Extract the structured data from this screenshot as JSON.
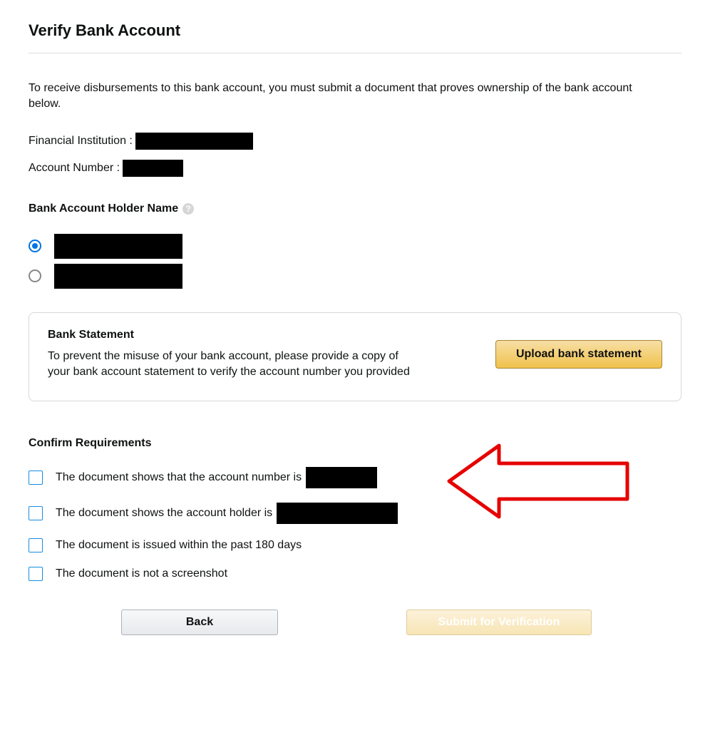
{
  "page": {
    "title": "Verify Bank Account",
    "intro": "To receive disbursements to this bank account, you must submit a document that proves ownership of the bank account below."
  },
  "fields": {
    "financial_institution_label": "Financial Institution :",
    "account_number_label": "Account Number :"
  },
  "holder": {
    "heading": "Bank Account Holder Name"
  },
  "statement": {
    "title": "Bank Statement",
    "desc": "To prevent the misuse of your bank account, please provide a copy of your bank account statement to verify the account number you provided",
    "upload_label": "Upload bank statement"
  },
  "confirm": {
    "heading": "Confirm Requirements",
    "items": [
      "The document shows that the account number is",
      "The document shows the account holder is",
      "The document is issued within the past 180 days",
      "The document is not a screenshot"
    ]
  },
  "buttons": {
    "back": "Back",
    "submit": "Submit for Verification"
  }
}
